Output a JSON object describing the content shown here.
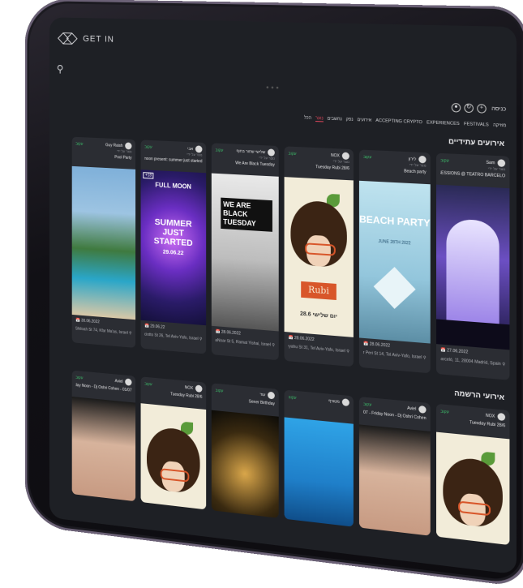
{
  "brand": {
    "name": "GET IN"
  },
  "nav": {
    "login": "כניסה",
    "menu": [
      "מוזיקה",
      "FESTIVALS",
      "EXPERIENCES",
      "ACCEPTING CRYPTO",
      "אירועים",
      "נפק",
      "נחשבים",
      "נוער",
      "הכל"
    ]
  },
  "sections": {
    "upcoming": "אירועים עתידיים",
    "registration": "אירועי הרשמה"
  },
  "upcoming": [
    {
      "org": "Sam",
      "follow": "עקוב",
      "sub": "נוצר על ידי",
      "title": "SUMMER SESSIONS @ TEATRO BARCELO",
      "date": "27.06.2022",
      "loc": "C. de Barceló, 11, 28004 Madrid, Spain"
    },
    {
      "org": "לירון",
      "follow": "עקוב",
      "sub": "נוצר על ידי",
      "title": "Beach party",
      "date": "28.06.2022",
      "loc": "Eliezer Peri St 14, Tel Aviv-Yafo, Israel",
      "poster_title": "BEACH PARTY",
      "poster_sub": "JUNE 28TH 2022"
    },
    {
      "org": "NOX",
      "follow": "עקוב",
      "sub": "נוצר על ידי",
      "title": "Tuesday Rubi 28/6",
      "date": "28.06.2022",
      "loc": "Yirmeyahu St 31, Tel Aviv-Yafo, Israel",
      "poster_title": "Rubi",
      "poster_sub": "יום שלישי 28.6"
    },
    {
      "org": "שלישי שחור בחוף",
      "follow": "עקוב",
      "sub": "נוצר על ידי",
      "title": "We Are Black Tuesday",
      "date": "28.06.2022",
      "loc": "Moreshet HaNoar St 5, Ramat Yishai, Israel",
      "poster_title": "WE ARE BLACK TUESDAY"
    },
    {
      "org": "אבי",
      "follow": "עקוב",
      "sub": "נוצר על ידי",
      "title": "Full moon present: summer just started",
      "date": "29.06.22",
      "loc": "De Picciotto St 26, Tel Aviv-Yafo, Israel",
      "poster_title": "SUMMER JUST STARTED",
      "poster_sub": "29.06.22",
      "poster_head": "FULL MOON",
      "badge": "+18"
    },
    {
      "org": "Guy Raish",
      "follow": "עקוב",
      "sub": "נוצר על ידי",
      "title": "Pool Party",
      "date": "30.06.2022",
      "loc": "Ha-Shiloah St 74, Kfar Ma'as, Israel"
    }
  ],
  "registration": [
    {
      "org": "NOX",
      "follow": "עקוב",
      "title": "Tuesday Rubi 28/6"
    },
    {
      "org": "Aviel",
      "follow": "עקוב",
      "title": "Open Air 01/07 - Friday Noon - Dj Oshri Cohen"
    },
    {
      "org": "מטורף",
      "follow": "עקוב",
      "title": ""
    },
    {
      "org": "עוד",
      "follow": "עקוב",
      "title": "Sener Birthday"
    },
    {
      "org": "NOX",
      "follow": "עקוב",
      "title": "Tuesday Rubi 28/6"
    },
    {
      "org": "Aviel",
      "follow": "עקוב",
      "title": "01/07 - Friday Noon - Dj Oshri Cohen"
    }
  ]
}
